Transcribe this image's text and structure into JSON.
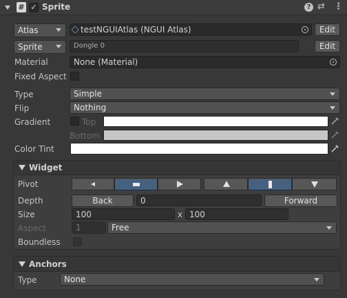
{
  "header": {
    "title": "Sprite",
    "enabled": true
  },
  "atlas": {
    "dropdown": "Atlas",
    "value": "testNGUIAtlas (NGUI Atlas)",
    "edit": "Edit"
  },
  "sprite": {
    "dropdown": "Sprite",
    "value": "Dongle 0",
    "edit": "Edit"
  },
  "material": {
    "label": "Material",
    "value": "None (Material)"
  },
  "fixed_aspect": {
    "label": "Fixed Aspect",
    "checked": false
  },
  "type": {
    "label": "Type",
    "value": "Simple"
  },
  "flip": {
    "label": "Flip",
    "value": "Nothing"
  },
  "gradient": {
    "label": "Gradient",
    "top_label": "Top",
    "bottom_label": "Bottom",
    "top_color": "#ffffff",
    "bottom_color": "#c6c6c6"
  },
  "color_tint": {
    "label": "Color Tint",
    "color": "#ffffff"
  },
  "widget": {
    "title": "Widget",
    "pivot_label": "Pivot",
    "pivot_h_selected": "center",
    "pivot_v_selected": "center",
    "depth_label": "Depth",
    "back": "Back",
    "depth_value": "0",
    "forward": "Forward",
    "size_label": "Size",
    "width": "100",
    "x_sep": "x",
    "height": "100",
    "aspect_label": "Aspect",
    "aspect_value": "1",
    "aspect_mode": "Free",
    "boundless_label": "Boundless"
  },
  "anchors": {
    "title": "Anchors",
    "type_label": "Type",
    "type_value": "None"
  },
  "colors": {
    "background": "#383838",
    "field": "#2a2a2a",
    "selected": "#46607f",
    "button": "#585858"
  }
}
